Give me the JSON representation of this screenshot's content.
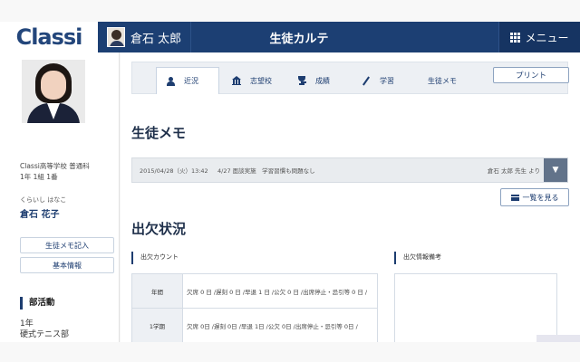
{
  "header": {
    "logo": "Classi",
    "user_name": "倉石 太郎",
    "title": "生徒カルテ",
    "menu_label": "メニュー"
  },
  "sidebar": {
    "school_line1": "Classi高等学校 普通科",
    "school_line2": "1年 1組 1番",
    "student_kana": "くらいし はなこ",
    "student_name": "倉石 花子",
    "memo_button": "生徒メモ記入",
    "info_button": "基本情報",
    "club_heading": "部活動",
    "club_line1": "1年",
    "club_line2": "硬式テニス部"
  },
  "tabs": [
    {
      "label": "近況",
      "icon": "person-icon"
    },
    {
      "label": "志望校",
      "icon": "school-icon"
    },
    {
      "label": "成績",
      "icon": "trophy-icon"
    },
    {
      "label": "学習",
      "icon": "pen-icon"
    },
    {
      "label": "生徒メモ",
      "icon": ""
    }
  ],
  "print_label": "プリント",
  "memo": {
    "heading": "生徒メモ",
    "date": "2015/04/28（火）13:42",
    "body": "4/27 面談実施　学習習慣も問題なし",
    "author": "倉石 太郎 先生 より",
    "list_button": "一覧を見る"
  },
  "attendance": {
    "heading": "出欠状況",
    "count_label": "出欠カウント",
    "notes_label": "出欠情報備考",
    "rows": [
      {
        "label": "年間",
        "value": "欠席 0 日 /遅刻 0 日 /早退 1 日 /公欠 0 日 /出席停止・忌引等 0 日 /"
      },
      {
        "label": "1学期",
        "value": "欠席 0日 /遅刻 0日 /早退 1日 /公欠 0日 /出席停止・忌引等 0日 /"
      }
    ]
  },
  "colors": {
    "header_bg": "#1c3f73",
    "accent": "#1d3d70",
    "logo_i": "#2b9fe0"
  }
}
